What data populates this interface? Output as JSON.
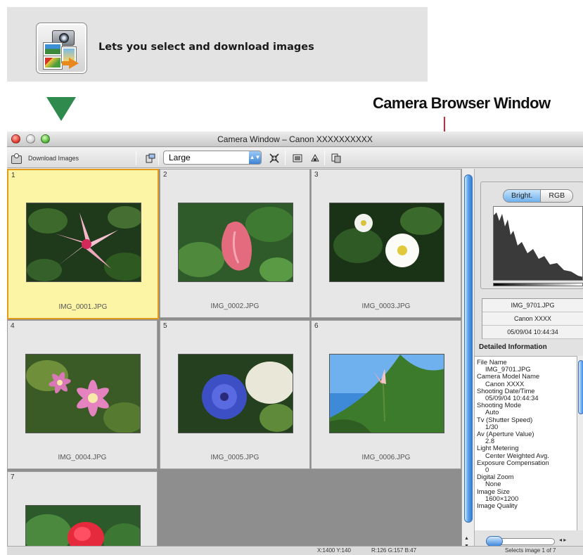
{
  "banner": {
    "text": "Lets you select and download images",
    "icon": "camera-download-icon"
  },
  "callout": {
    "label": "Camera Browser Window"
  },
  "window": {
    "title": "Camera Window – Canon XXXXXXXXXX",
    "toolbar": {
      "download_label": "Download Images",
      "size_select_value": "Large"
    },
    "thumbnails": [
      {
        "number": "1",
        "filename": "IMG_0001.JPG",
        "selected": true
      },
      {
        "number": "2",
        "filename": "IMG_0002.JPG",
        "selected": false
      },
      {
        "number": "3",
        "filename": "IMG_0003.JPG",
        "selected": false
      },
      {
        "number": "4",
        "filename": "IMG_0004.JPG",
        "selected": false
      },
      {
        "number": "5",
        "filename": "IMG_0005.JPG",
        "selected": false
      },
      {
        "number": "6",
        "filename": "IMG_0006.JPG",
        "selected": false
      },
      {
        "number": "7",
        "filename": "",
        "selected": false
      }
    ],
    "histogram": {
      "tabs": [
        "Bright.",
        "RGB"
      ],
      "active_tab": "Bright."
    },
    "image_info": {
      "filename": "IMG_9701.JPG",
      "camera": "Canon XXXX",
      "datetime": "05/09/04 10:44:34"
    },
    "detail": {
      "title": "Detailed Information",
      "items": [
        {
          "key": "File Name",
          "value": "IMG_9701.JPG"
        },
        {
          "key": "Camera Model Name",
          "value": "Canon XXXX"
        },
        {
          "key": "Shooting Date/Time",
          "value": "05/09/04 10:44:34"
        },
        {
          "key": "Shooting Mode",
          "value": "Auto"
        },
        {
          "key": "Tv (Shutter Speed)",
          "value": "1/30"
        },
        {
          "key": "Av (Aperture Value)",
          "value": "2.8"
        },
        {
          "key": "Light Metering",
          "value": "Center Weighted Avg."
        },
        {
          "key": "Exposure Compensation",
          "value": "0"
        },
        {
          "key": "Digital Zoom",
          "value": "None"
        },
        {
          "key": "Image Size",
          "value": "1600×1200"
        },
        {
          "key": "Image Quality",
          "value": ""
        }
      ]
    },
    "status": {
      "coords": "X:1400 Y:140",
      "rgb": "R:126 G:157 B:47",
      "selection": "Selects image 1 of 7"
    }
  }
}
